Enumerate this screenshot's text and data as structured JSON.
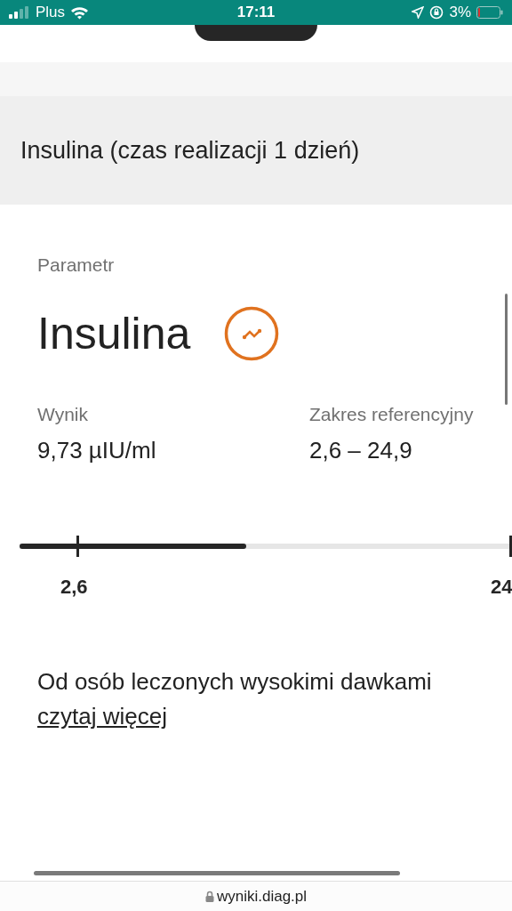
{
  "status_bar": {
    "carrier": "Plus",
    "time": "17:11",
    "battery": "3%"
  },
  "section": {
    "title": "Insulina (czas realizacji 1 dzień)"
  },
  "parameter": {
    "label": "Parametr",
    "name": "Insulina"
  },
  "result": {
    "label": "Wynik",
    "value": "9,73 µIU/ml"
  },
  "reference": {
    "label": "Zakres referencyjny",
    "value": "2,6 – 24,9"
  },
  "scale": {
    "level": 0.46,
    "ticks": [
      "2,6",
      "24"
    ]
  },
  "note": {
    "text": "Od osób leczonych wysokimi dawkami",
    "link": "czytaj więcej"
  },
  "browser": {
    "url": "wyniki.diag.pl"
  }
}
